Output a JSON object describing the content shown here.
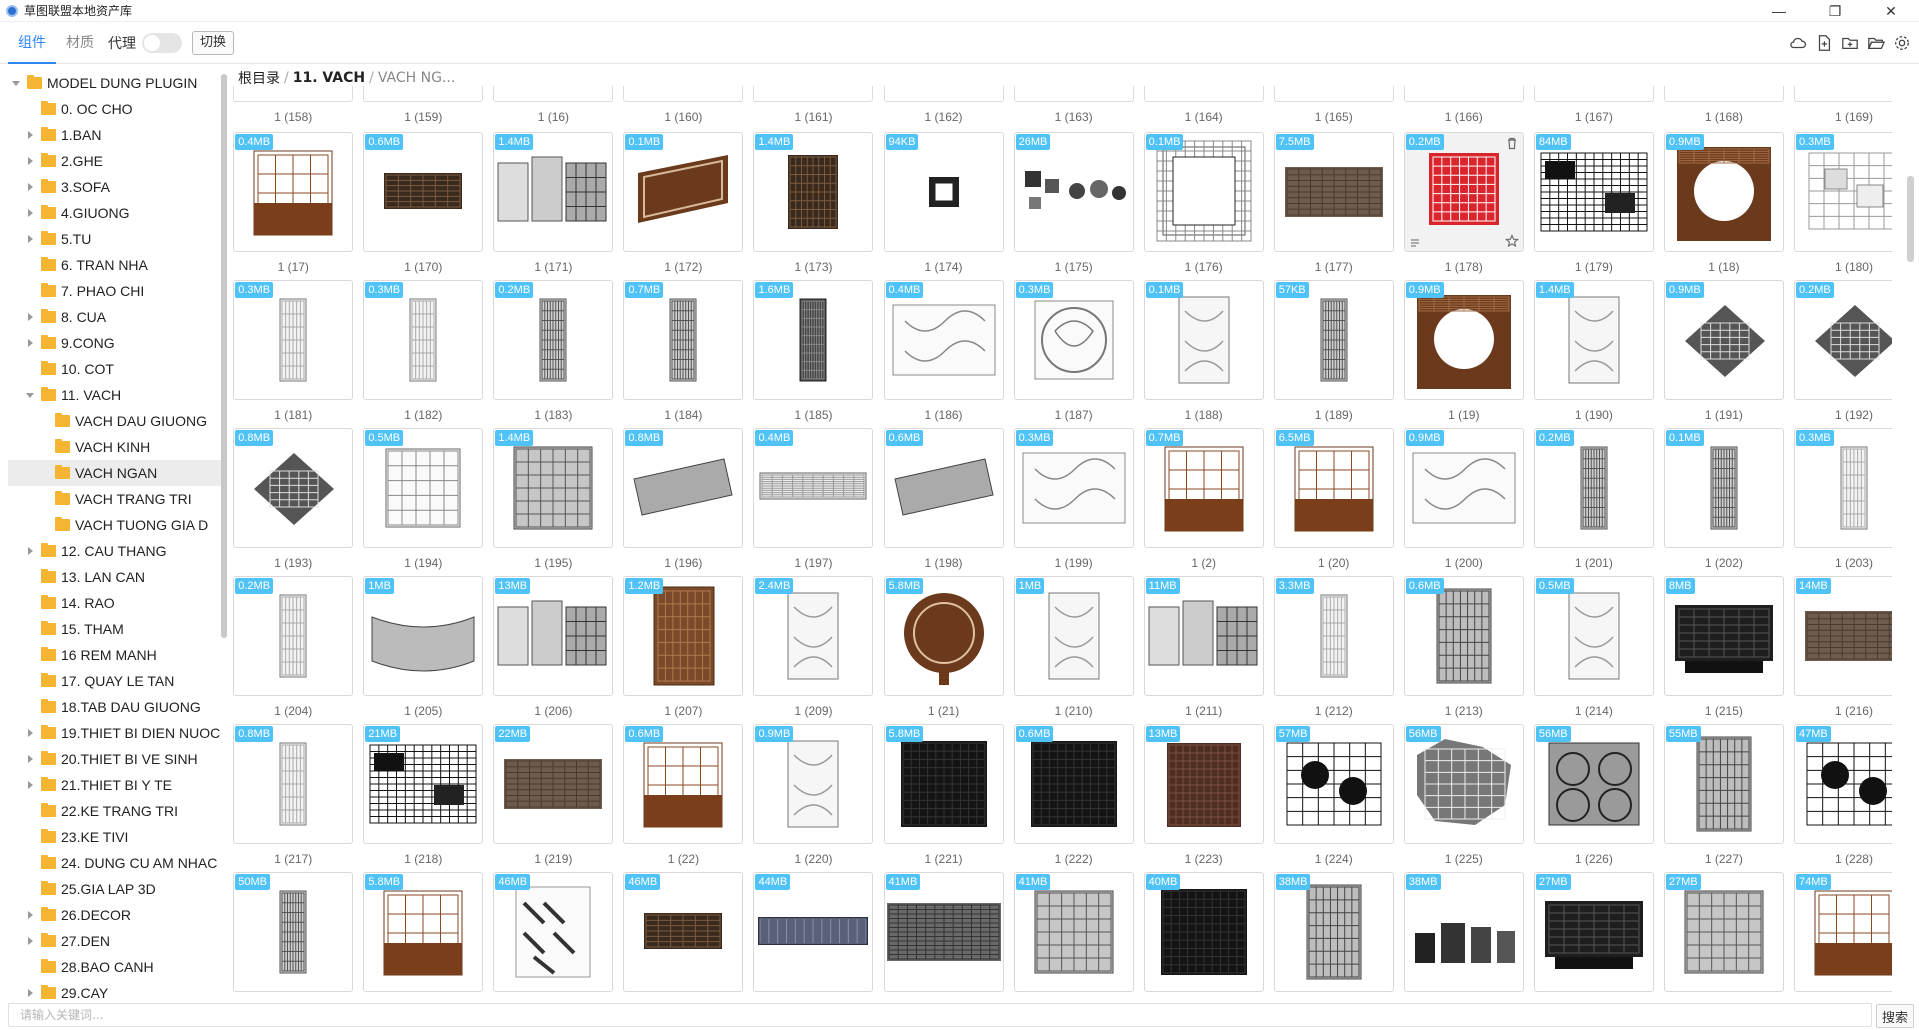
{
  "window": {
    "title": "草图联盟本地资产库",
    "controls": {
      "minimize": "—",
      "maximize": "❐",
      "close": "✕"
    }
  },
  "toolbar": {
    "tabs": [
      {
        "label": "组件",
        "active": true
      },
      {
        "label": "材质",
        "active": false
      }
    ],
    "proxy_label": "代理",
    "proxy_on": false,
    "switch_label": "切换",
    "icons": [
      "cloud-icon",
      "add-file-icon",
      "add-folder-icon",
      "open-folder-icon",
      "gear-icon"
    ]
  },
  "sidebar": {
    "items": [
      {
        "label": "MODEL DUNG PLUGIN",
        "depth": 0,
        "caret": "expanded",
        "selected": false
      },
      {
        "label": "0. OC CHO",
        "depth": 1,
        "caret": "none",
        "selected": false
      },
      {
        "label": "1.BAN",
        "depth": 1,
        "caret": "collapsed",
        "selected": false
      },
      {
        "label": "2.GHE",
        "depth": 1,
        "caret": "collapsed",
        "selected": false
      },
      {
        "label": "3.SOFA",
        "depth": 1,
        "caret": "collapsed",
        "selected": false
      },
      {
        "label": "4.GIUONG",
        "depth": 1,
        "caret": "collapsed",
        "selected": false
      },
      {
        "label": "5.TU",
        "depth": 1,
        "caret": "collapsed",
        "selected": false
      },
      {
        "label": "6. TRAN NHA",
        "depth": 1,
        "caret": "none",
        "selected": false
      },
      {
        "label": "7. PHAO CHI",
        "depth": 1,
        "caret": "none",
        "selected": false
      },
      {
        "label": "8. CUA",
        "depth": 1,
        "caret": "collapsed",
        "selected": false
      },
      {
        "label": "9.CONG",
        "depth": 1,
        "caret": "collapsed",
        "selected": false
      },
      {
        "label": "10. COT",
        "depth": 1,
        "caret": "none",
        "selected": false
      },
      {
        "label": "11. VACH",
        "depth": 1,
        "caret": "expanded",
        "selected": false
      },
      {
        "label": "VACH DAU GIUONG",
        "depth": 2,
        "caret": "none",
        "selected": false
      },
      {
        "label": "VACH KINH",
        "depth": 2,
        "caret": "none",
        "selected": false
      },
      {
        "label": "VACH NGAN",
        "depth": 2,
        "caret": "none",
        "selected": true
      },
      {
        "label": "VACH TRANG TRI",
        "depth": 2,
        "caret": "none",
        "selected": false
      },
      {
        "label": "VACH TUONG GIA D",
        "depth": 2,
        "caret": "none",
        "selected": false
      },
      {
        "label": "12. CAU THANG",
        "depth": 1,
        "caret": "collapsed",
        "selected": false
      },
      {
        "label": "13. LAN CAN",
        "depth": 1,
        "caret": "none",
        "selected": false
      },
      {
        "label": "14. RAO",
        "depth": 1,
        "caret": "none",
        "selected": false
      },
      {
        "label": "15. THAM",
        "depth": 1,
        "caret": "none",
        "selected": false
      },
      {
        "label": "16 REM MANH",
        "depth": 1,
        "caret": "none",
        "selected": false
      },
      {
        "label": "17. QUAY LE TAN",
        "depth": 1,
        "caret": "none",
        "selected": false
      },
      {
        "label": "18.TAB DAU GIUONG",
        "depth": 1,
        "caret": "none",
        "selected": false
      },
      {
        "label": "19.THIET BI DIEN NUOC",
        "depth": 1,
        "caret": "collapsed",
        "selected": false
      },
      {
        "label": "20.THIET BI VE SINH",
        "depth": 1,
        "caret": "collapsed",
        "selected": false
      },
      {
        "label": "21.THIET BI Y TE",
        "depth": 1,
        "caret": "collapsed",
        "selected": false
      },
      {
        "label": "22.KE TRANG TRI",
        "depth": 1,
        "caret": "none",
        "selected": false
      },
      {
        "label": "23.KE TIVI",
        "depth": 1,
        "caret": "none",
        "selected": false
      },
      {
        "label": "24. DUNG CU AM NHAC",
        "depth": 1,
        "caret": "none",
        "selected": false
      },
      {
        "label": "25.GIA LAP 3D",
        "depth": 1,
        "caret": "none",
        "selected": false
      },
      {
        "label": "26.DECOR",
        "depth": 1,
        "caret": "collapsed",
        "selected": false
      },
      {
        "label": "27.DEN",
        "depth": 1,
        "caret": "collapsed",
        "selected": false
      },
      {
        "label": "28.BAO CANH",
        "depth": 1,
        "caret": "none",
        "selected": false
      },
      {
        "label": "29.CAY",
        "depth": 1,
        "caret": "collapsed",
        "selected": false
      }
    ]
  },
  "breadcrumb": [
    "根目录",
    "11. VACH",
    "VACH NG..."
  ],
  "top_row_labels": [
    "1 (158)",
    "1 (159)",
    "1 (16)",
    "1 (160)",
    "1 (161)",
    "1 (162)",
    "1 (163)",
    "1 (164)",
    "1 (165)",
    "1 (166)",
    "1 (167)",
    "1 (168)",
    "1 (169)"
  ],
  "rows": [
    {
      "labels": [
        "1 (17)",
        "1 (170)",
        "1 (171)",
        "1 (172)",
        "1 (173)",
        "1 (174)",
        "1 (175)",
        "1 (176)",
        "1 (177)",
        "1 (178)",
        "1 (179)",
        "1 (18)",
        "1 (180)"
      ],
      "sizes": [
        "0.4MB",
        "0.6MB",
        "1.4MB",
        "0.1MB",
        "1.4MB",
        "94KB",
        "26MB",
        "0.1MB",
        "7.5MB",
        "0.2MB",
        "84MB",
        "0.9MB",
        "0.3MB"
      ],
      "thumbs": [
        "wood-shelf",
        "dark-wide",
        "multi-panel",
        "wood-diag",
        "dark-square",
        "small-square",
        "scatter",
        "frame",
        "brown-wide",
        "red-square",
        "black-scatter",
        "wood-moon",
        "grey-blocks"
      ]
    },
    {
      "labels": [
        "1 (181)",
        "1 (182)",
        "1 (183)",
        "1 (184)",
        "1 (185)",
        "1 (186)",
        "1 (187)",
        "1 (188)",
        "1 (189)",
        "1 (19)",
        "1 (190)",
        "1 (191)",
        "1 (192)"
      ],
      "sizes": [
        "0.3MB",
        "0.3MB",
        "0.2MB",
        "0.7MB",
        "1.6MB",
        "0.4MB",
        "0.3MB",
        "0.1MB",
        "57KB",
        "0.9MB",
        "1.4MB",
        "0.9MB",
        "0.2MB"
      ],
      "thumbs": [
        "light-narrow",
        "light-narrow",
        "grey-narrow",
        "grey-narrow",
        "dark-narrow",
        "light-wide",
        "light-circle",
        "light-medium",
        "grey-narrow",
        "wood-moon",
        "light-medium",
        "dark-diamond",
        "dark-diamond"
      ]
    },
    {
      "labels": [
        "1 (193)",
        "1 (194)",
        "1 (195)",
        "1 (196)",
        "1 (197)",
        "1 (198)",
        "1 (199)",
        "1 (2)",
        "1 (20)",
        "1 (200)",
        "1 (201)",
        "1 (202)",
        "1 (203)"
      ],
      "sizes": [
        "0.8MB",
        "0.5MB",
        "1.4MB",
        "0.8MB",
        "0.4MB",
        "0.6MB",
        "0.3MB",
        "0.7MB",
        "6.5MB",
        "0.9MB",
        "0.2MB",
        "0.1MB",
        "0.3MB"
      ],
      "thumbs": [
        "dark-diamond",
        "light-square",
        "grey-square",
        "grey-strip",
        "light-strip",
        "grey-strip",
        "light-wide",
        "wood-shelf",
        "wood-shelf",
        "light-wide",
        "grey-narrow",
        "grey-narrow",
        "light-narrow"
      ]
    },
    {
      "labels": [
        "1 (204)",
        "1 (205)",
        "1 (206)",
        "1 (207)",
        "1 (209)",
        "1 (21)",
        "1 (210)",
        "1 (211)",
        "1 (212)",
        "1 (213)",
        "1 (214)",
        "1 (215)",
        "1 (216)"
      ],
      "sizes": [
        "0.2MB",
        "1MB",
        "13MB",
        "1.2MB",
        "2.4MB",
        "5.8MB",
        "1MB",
        "11MB",
        "3.3MB",
        "0.6MB",
        "0.5MB",
        "8MB",
        "14MB"
      ],
      "thumbs": [
        "light-narrow",
        "grey-curve",
        "multi-panel",
        "wood-narrow",
        "light-medium",
        "wood-circle",
        "light-medium",
        "multi-panel",
        "light-narrow",
        "grey-medium",
        "light-medium",
        "black-wide",
        "brown-wide"
      ]
    },
    {
      "labels": [
        "1 (217)",
        "1 (218)",
        "1 (219)",
        "1 (22)",
        "1 (220)",
        "1 (221)",
        "1 (222)",
        "1 (223)",
        "1 (224)",
        "1 (225)",
        "1 (226)",
        "1 (227)",
        "1 (228)"
      ],
      "sizes": [
        "0.8MB",
        "21MB",
        "22MB",
        "0.6MB",
        "0.9MB",
        "5.8MB",
        "0.6MB",
        "13MB",
        "57MB",
        "56MB",
        "56MB",
        "55MB",
        "47MB"
      ],
      "thumbs": [
        "light-narrow",
        "black-scatter",
        "brown-wide",
        "wood-shelf",
        "light-medium",
        "black-square",
        "black-square",
        "brown-square",
        "black-hex",
        "grey-web",
        "grey-circles",
        "grey-medium",
        "black-hex"
      ]
    },
    {
      "labels": [
        "",
        "",
        "",
        "",
        "",
        "",
        "",
        "",
        "",
        "",
        "",
        "",
        ""
      ],
      "sizes": [
        "50MB",
        "5.8MB",
        "46MB",
        "46MB",
        "44MB",
        "41MB",
        "41MB",
        "40MB",
        "38MB",
        "38MB",
        "27MB",
        "27MB",
        "74MB"
      ],
      "thumbs": [
        "grey-narrow",
        "wood-shelf",
        "light-diag",
        "dark-wide",
        "navy-strip",
        "grey-band",
        "grey-square",
        "black-square",
        "grey-medium",
        "black-multi",
        "black-wide",
        "grey-square",
        "wood-shelf"
      ]
    }
  ],
  "colors": {
    "accent": "#2f86f6",
    "badge": "#4fc3f7",
    "folder": "#f4b532"
  },
  "search": {
    "placeholder": "请输入关键词...",
    "value": "",
    "button_label": "搜索"
  }
}
